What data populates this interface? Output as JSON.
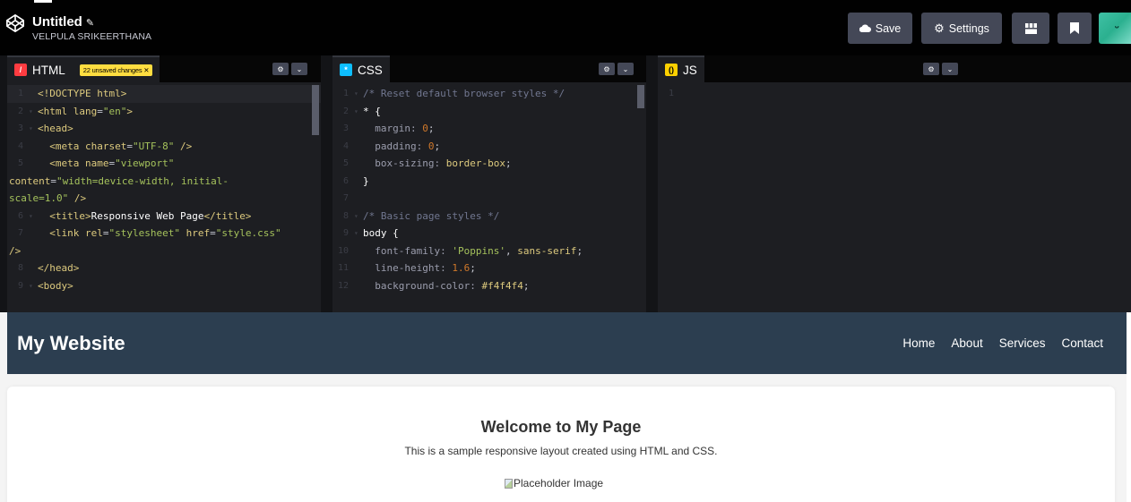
{
  "header": {
    "project_title": "Untitled",
    "author": "VELPULA SRIKEERTHANA",
    "save_label": "Save",
    "settings_label": "Settings"
  },
  "icons": {
    "logo": "codepen-logo-icon",
    "edit": "pencil-icon",
    "save": "cloud-icon",
    "settings": "gear-icon",
    "layout": "layout-icon",
    "bookmark": "bookmark-icon",
    "pane_settings": "gear-icon",
    "pane_collapse": "chevron-down-icon"
  },
  "colors": {
    "accent_html": "#ff3c41",
    "accent_css": "#0ebeff",
    "accent_js": "#fcd000",
    "unsaved_badge": "#ffdd40",
    "site_header": "#2c3e50"
  },
  "editors": {
    "html": {
      "label": "HTML",
      "unsaved": "22 unsaved changes ✕",
      "lines": [
        {
          "n": "1",
          "fold": "",
          "segs": [
            [
              "tag",
              "<!DOCTYPE html>"
            ]
          ]
        },
        {
          "n": "2",
          "fold": "▾",
          "segs": [
            [
              "tag",
              "<html "
            ],
            [
              "attr",
              "lang"
            ],
            [
              "plain",
              "="
            ],
            [
              "val",
              "\"en\""
            ],
            [
              "tag",
              ">"
            ]
          ]
        },
        {
          "n": "3",
          "fold": "▾",
          "segs": [
            [
              "tag",
              "<head>"
            ]
          ]
        },
        {
          "n": "4",
          "fold": "",
          "segs": [
            [
              "plain",
              "  "
            ],
            [
              "tag",
              "<meta "
            ],
            [
              "attr",
              "charset"
            ],
            [
              "plain",
              "="
            ],
            [
              "val",
              "\"UTF-8\""
            ],
            [
              "tag",
              " />"
            ]
          ]
        },
        {
          "n": "5",
          "fold": "",
          "segs": [
            [
              "plain",
              "  "
            ],
            [
              "tag",
              "<meta "
            ],
            [
              "attr",
              "name"
            ],
            [
              "plain",
              "="
            ],
            [
              "val",
              "\"viewport\""
            ]
          ]
        },
        {
          "n": "",
          "fold": "",
          "wrap": true,
          "segs": [
            [
              "attr",
              "content"
            ],
            [
              "plain",
              "="
            ],
            [
              "val",
              "\"width=device-width, initial-"
            ]
          ]
        },
        {
          "n": "",
          "fold": "",
          "wrap": true,
          "segs": [
            [
              "val",
              "scale=1.0\""
            ],
            [
              "tag",
              " />"
            ]
          ]
        },
        {
          "n": "6",
          "fold": "▾",
          "segs": [
            [
              "plain",
              "  "
            ],
            [
              "tag",
              "<title>"
            ],
            [
              "sel",
              "Responsive Web Page"
            ],
            [
              "tag",
              "</title>"
            ]
          ]
        },
        {
          "n": "7",
          "fold": "",
          "segs": [
            [
              "plain",
              "  "
            ],
            [
              "tag",
              "<link "
            ],
            [
              "attr",
              "rel"
            ],
            [
              "plain",
              "="
            ],
            [
              "val",
              "\"stylesheet\""
            ],
            [
              "plain",
              " "
            ],
            [
              "attr",
              "href"
            ],
            [
              "plain",
              "="
            ],
            [
              "val",
              "\"style.css\""
            ]
          ]
        },
        {
          "n": "",
          "fold": "",
          "wrap": true,
          "segs": [
            [
              "tag",
              "/>"
            ]
          ]
        },
        {
          "n": "8",
          "fold": "",
          "segs": [
            [
              "tag",
              "</head>"
            ]
          ]
        },
        {
          "n": "9",
          "fold": "▾",
          "segs": [
            [
              "tag",
              "<body>"
            ]
          ]
        }
      ]
    },
    "css": {
      "label": "CSS",
      "lines": [
        {
          "n": "1",
          "fold": "▾",
          "segs": [
            [
              "cmt",
              "/* Reset default browser styles */"
            ]
          ]
        },
        {
          "n": "2",
          "fold": "▾",
          "segs": [
            [
              "sel",
              "* {"
            ]
          ]
        },
        {
          "n": "3",
          "fold": "",
          "segs": [
            [
              "plain",
              "  "
            ],
            [
              "prop",
              "margin: "
            ],
            [
              "num",
              "0"
            ],
            [
              "plain",
              ";"
            ]
          ]
        },
        {
          "n": "4",
          "fold": "",
          "segs": [
            [
              "plain",
              "  "
            ],
            [
              "prop",
              "padding: "
            ],
            [
              "num",
              "0"
            ],
            [
              "plain",
              ";"
            ]
          ]
        },
        {
          "n": "5",
          "fold": "",
          "segs": [
            [
              "plain",
              "  "
            ],
            [
              "prop",
              "box-sizing: "
            ],
            [
              "kw",
              "border-box"
            ],
            [
              "plain",
              ";"
            ]
          ]
        },
        {
          "n": "6",
          "fold": "",
          "segs": [
            [
              "sel",
              "}"
            ]
          ]
        },
        {
          "n": "7",
          "fold": "",
          "segs": []
        },
        {
          "n": "8",
          "fold": "▾",
          "segs": [
            [
              "cmt",
              "/* Basic page styles */"
            ]
          ]
        },
        {
          "n": "9",
          "fold": "▾",
          "segs": [
            [
              "sel",
              "body {"
            ]
          ]
        },
        {
          "n": "10",
          "fold": "",
          "segs": [
            [
              "plain",
              "  "
            ],
            [
              "prop",
              "font-family: "
            ],
            [
              "val",
              "'Poppins'"
            ],
            [
              "plain",
              ", "
            ],
            [
              "kw",
              "sans-serif"
            ],
            [
              "plain",
              ";"
            ]
          ]
        },
        {
          "n": "11",
          "fold": "",
          "segs": [
            [
              "plain",
              "  "
            ],
            [
              "prop",
              "line-height: "
            ],
            [
              "num",
              "1.6"
            ],
            [
              "plain",
              ";"
            ]
          ]
        },
        {
          "n": "12",
          "fold": "",
          "segs": [
            [
              "plain",
              "  "
            ],
            [
              "prop",
              "background-color: "
            ],
            [
              "kw",
              "#f4f4f4"
            ],
            [
              "plain",
              ";"
            ]
          ]
        }
      ]
    },
    "js": {
      "label": "JS",
      "lines": [
        {
          "n": "1",
          "fold": "",
          "segs": []
        }
      ]
    }
  },
  "preview": {
    "site_title": "My Website",
    "nav": [
      "Home",
      "About",
      "Services",
      "Contact"
    ],
    "heading": "Welcome to My Page",
    "text": "This is a sample responsive layout created using HTML and CSS.",
    "image_alt": "Placeholder Image"
  }
}
